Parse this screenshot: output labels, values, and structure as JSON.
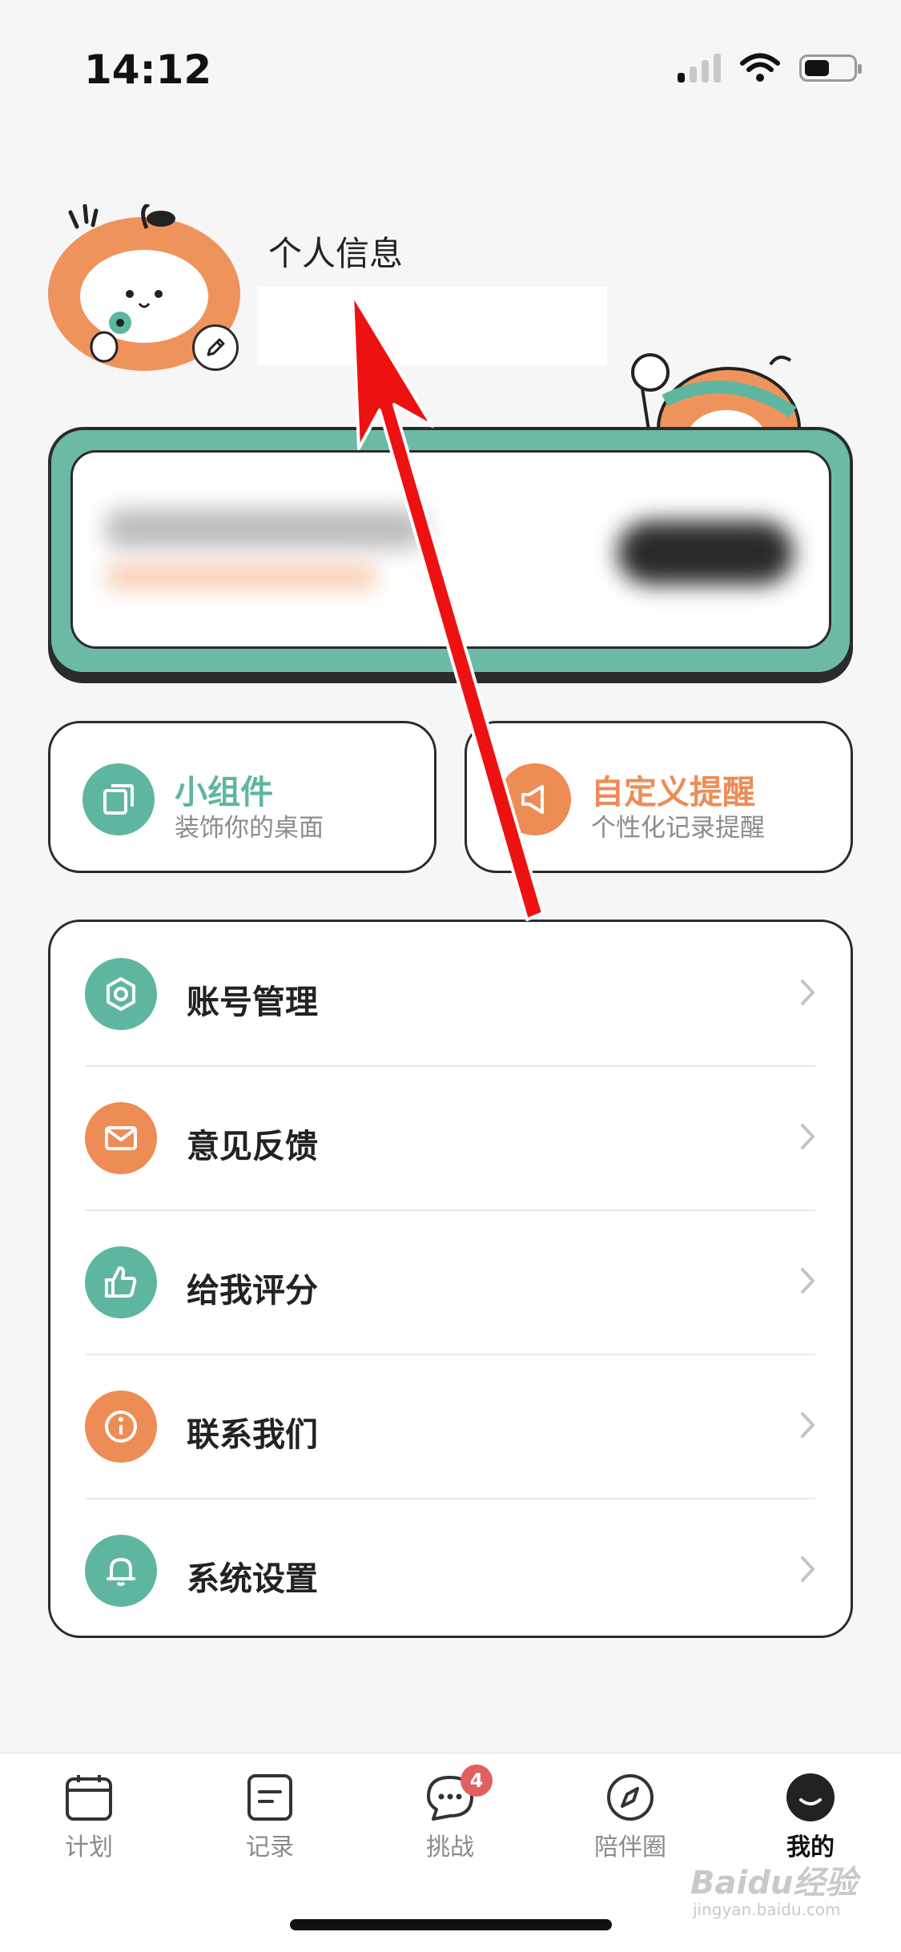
{
  "status_bar": {
    "time": "14:12"
  },
  "profile": {
    "title": "个人信息"
  },
  "quick_cards": [
    {
      "title": "小组件",
      "subtitle": "装饰你的桌面",
      "color": "#5fb6a0",
      "icon": "copy-icon"
    },
    {
      "title": "自定义提醒",
      "subtitle": "个性化记录提醒",
      "color": "#ee8c56",
      "icon": "megaphone-icon"
    }
  ],
  "menu": {
    "items": [
      {
        "label": "账号管理",
        "icon": "hexagon-icon",
        "color": "#5fb6a0"
      },
      {
        "label": "意见反馈",
        "icon": "mail-icon",
        "color": "#ee8c56"
      },
      {
        "label": "给我评分",
        "icon": "thumbs-up-icon",
        "color": "#5fb6a0"
      },
      {
        "label": "联系我们",
        "icon": "info-icon",
        "color": "#ee8c56"
      },
      {
        "label": "系统设置",
        "icon": "bell-icon",
        "color": "#5fb6a0"
      }
    ]
  },
  "tabs": [
    {
      "label": "计划",
      "icon": "calendar-icon"
    },
    {
      "label": "记录",
      "icon": "document-icon"
    },
    {
      "label": "挑战",
      "icon": "chat-bubble-icon",
      "badge": "4"
    },
    {
      "label": "陪伴圈",
      "icon": "compass-icon"
    },
    {
      "label": "我的",
      "icon": "profile-face-icon",
      "active": true
    }
  ],
  "watermark": {
    "brand": "Baidu经验",
    "url": "jingyan.baidu.com"
  }
}
